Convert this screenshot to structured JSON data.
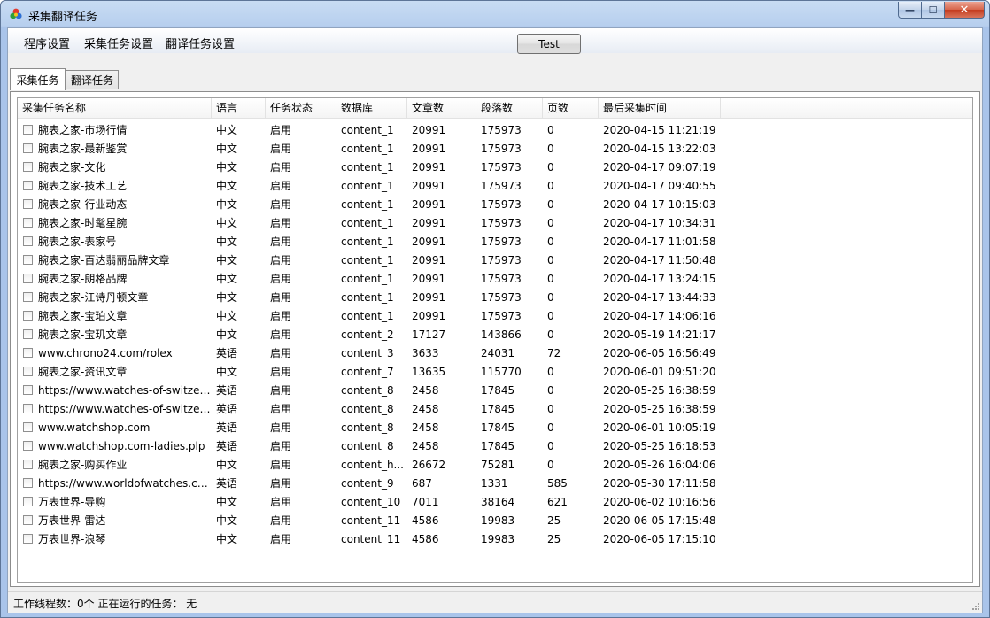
{
  "window": {
    "title": "采集翻译任务",
    "buttons": {
      "minimize": "—",
      "maximize": "☐",
      "close": "✕"
    }
  },
  "menu": [
    "程序设置",
    "采集任务设置",
    "翻译任务设置"
  ],
  "toolbar": {
    "test_label": "Test"
  },
  "tabs": [
    {
      "label": "采集任务",
      "active": true
    },
    {
      "label": "翻译任务",
      "active": false
    }
  ],
  "table": {
    "columns": [
      "采集任务名称",
      "语言",
      "任务状态",
      "数据库",
      "文章数",
      "段落数",
      "页数",
      "最后采集时间"
    ],
    "rows": [
      [
        "腕表之家-市场行情",
        "中文",
        "启用",
        "content_1",
        "20991",
        "175973",
        "0",
        "2020-04-15 11:21:19"
      ],
      [
        "腕表之家-最新鉴赏",
        "中文",
        "启用",
        "content_1",
        "20991",
        "175973",
        "0",
        "2020-04-15 13:22:03"
      ],
      [
        "腕表之家-文化",
        "中文",
        "启用",
        "content_1",
        "20991",
        "175973",
        "0",
        "2020-04-17 09:07:19"
      ],
      [
        "腕表之家-技术工艺",
        "中文",
        "启用",
        "content_1",
        "20991",
        "175973",
        "0",
        "2020-04-17 09:40:55"
      ],
      [
        "腕表之家-行业动态",
        "中文",
        "启用",
        "content_1",
        "20991",
        "175973",
        "0",
        "2020-04-17 10:15:03"
      ],
      [
        "腕表之家-时髦星腕",
        "中文",
        "启用",
        "content_1",
        "20991",
        "175973",
        "0",
        "2020-04-17 10:34:31"
      ],
      [
        "腕表之家-表家号",
        "中文",
        "启用",
        "content_1",
        "20991",
        "175973",
        "0",
        "2020-04-17 11:01:58"
      ],
      [
        "腕表之家-百达翡丽品牌文章",
        "中文",
        "启用",
        "content_1",
        "20991",
        "175973",
        "0",
        "2020-04-17 11:50:48"
      ],
      [
        "腕表之家-朗格品牌",
        "中文",
        "启用",
        "content_1",
        "20991",
        "175973",
        "0",
        "2020-04-17 13:24:15"
      ],
      [
        "腕表之家-江诗丹顿文章",
        "中文",
        "启用",
        "content_1",
        "20991",
        "175973",
        "0",
        "2020-04-17 13:44:33"
      ],
      [
        "腕表之家-宝珀文章",
        "中文",
        "启用",
        "content_1",
        "20991",
        "175973",
        "0",
        "2020-04-17 14:06:16"
      ],
      [
        "腕表之家-宝玑文章",
        "中文",
        "启用",
        "content_2",
        "17127",
        "143866",
        "0",
        "2020-05-19 14:21:17"
      ],
      [
        "www.chrono24.com/rolex",
        "英语",
        "启用",
        "content_3",
        "3633",
        "24031",
        "72",
        "2020-06-05 16:56:49"
      ],
      [
        "腕表之家-资讯文章",
        "中文",
        "启用",
        "content_7",
        "13635",
        "115770",
        "0",
        "2020-06-01 09:51:20"
      ],
      [
        "https://www.watches-of-switzerl...",
        "英语",
        "启用",
        "content_8",
        "2458",
        "17845",
        "0",
        "2020-05-25 16:38:59"
      ],
      [
        "https://www.watches-of-switzerl...",
        "英语",
        "启用",
        "content_8",
        "2458",
        "17845",
        "0",
        "2020-05-25 16:38:59"
      ],
      [
        "www.watchshop.com",
        "英语",
        "启用",
        "content_8",
        "2458",
        "17845",
        "0",
        "2020-06-01 10:05:19"
      ],
      [
        "www.watchshop.com-ladies.plp",
        "英语",
        "启用",
        "content_8",
        "2458",
        "17845",
        "0",
        "2020-05-25 16:18:53"
      ],
      [
        "腕表之家-购买作业",
        "中文",
        "启用",
        "content_h...",
        "26672",
        "75281",
        "0",
        "2020-05-26 16:04:06"
      ],
      [
        "https://www.worldofwatches.com",
        "英语",
        "启用",
        "content_9",
        "687",
        "1331",
        "585",
        "2020-05-30 17:11:58"
      ],
      [
        "万表世界-导购",
        "中文",
        "启用",
        "content_10",
        "7011",
        "38164",
        "621",
        "2020-06-02 10:16:56"
      ],
      [
        "万表世界-雷达",
        "中文",
        "启用",
        "content_11",
        "4586",
        "19983",
        "25",
        "2020-06-05 17:15:48"
      ],
      [
        "万表世界-浪琴",
        "中文",
        "启用",
        "content_11",
        "4586",
        "19983",
        "25",
        "2020-06-05 17:15:10"
      ]
    ]
  },
  "status": {
    "text": "工作线程数：0个  正在运行的任务： 无"
  }
}
